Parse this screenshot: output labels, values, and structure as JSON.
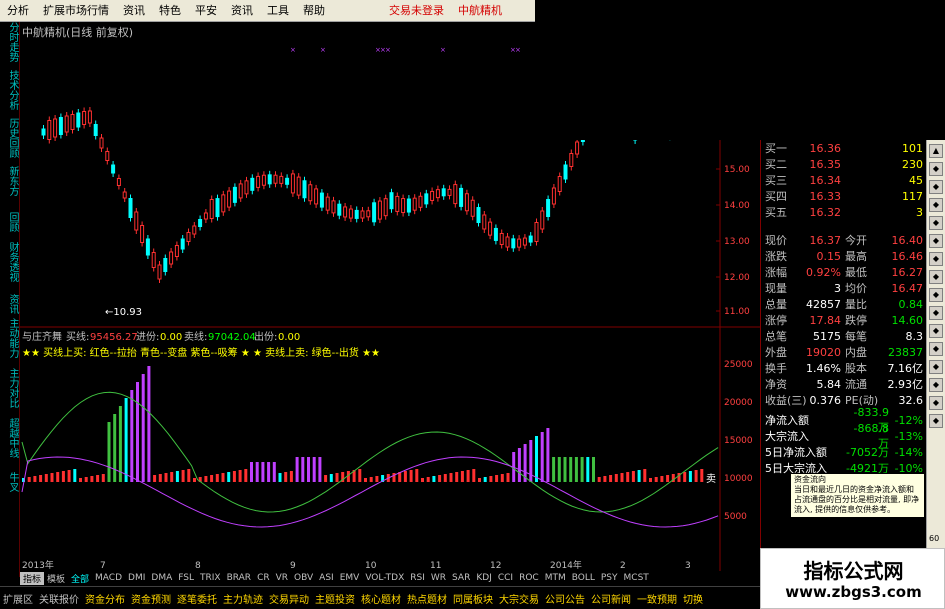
{
  "menubar": {
    "items": [
      "分析",
      "扩展市场行情",
      "资讯",
      "特色",
      "平安",
      "资讯",
      "工具",
      "帮助"
    ],
    "status": "交易未登录",
    "stock_name": "中航精机"
  },
  "left_nav": [
    "分时走势",
    "技术分析",
    "历史回顾",
    "新东方",
    "回顾",
    "财务透视",
    "资讯",
    "主动能力",
    "主力对比",
    "超越中线",
    "牛叉"
  ],
  "chart": {
    "title": "中航精机(日线 前复权)",
    "low_label": "←10.93",
    "price_axis": [
      "15.00",
      "14.00",
      "13.00",
      "12.00",
      "11.00"
    ],
    "indicator_title": "与庄齐舞",
    "indicator_values": {
      "buy_label": "买线:",
      "buy_value": "95456.27",
      "enter_label": "进份:",
      "enter_value": "0.00",
      "sell_label": "卖线:",
      "sell_value": "97042.04",
      "exit_label": "出份:",
      "exit_value": "0.00"
    },
    "legend_text": "★★ 买线上买: 红色--拉抬 青色--变盘 紫色--吸筹 ★ ★ 卖线上卖: 绿色--出货 ★★",
    "volume_axis": [
      "25000",
      "20000",
      "15000",
      "10000",
      "5000"
    ],
    "date_labels": [
      "2013年",
      "7",
      "8",
      "9",
      "10",
      "11",
      "12",
      "2014年",
      "2",
      "3"
    ],
    "sell_marker": "卖"
  },
  "quotes": {
    "buy": [
      {
        "label": "买一",
        "price": "16.36",
        "vol": "101"
      },
      {
        "label": "买二",
        "price": "16.35",
        "vol": "230"
      },
      {
        "label": "买三",
        "price": "16.34",
        "vol": "45"
      },
      {
        "label": "买四",
        "price": "16.33",
        "vol": "117"
      },
      {
        "label": "买五",
        "price": "16.32",
        "vol": "3"
      }
    ],
    "stats": [
      {
        "l1": "现价",
        "v1": "16.37",
        "c1": "red",
        "l2": "今开",
        "v2": "16.40",
        "c2": "red"
      },
      {
        "l1": "涨跌",
        "v1": "0.15",
        "c1": "red",
        "l2": "最高",
        "v2": "16.46",
        "c2": "red"
      },
      {
        "l1": "涨幅",
        "v1": "0.92%",
        "c1": "red",
        "l2": "最低",
        "v2": "16.27",
        "c2": "red"
      },
      {
        "l1": "现量",
        "v1": "3",
        "c1": "white",
        "l2": "均价",
        "v2": "16.47",
        "c2": "red"
      },
      {
        "l1": "总量",
        "v1": "42857",
        "c1": "white",
        "l2": "量比",
        "v2": "0.84",
        "c2": "green"
      },
      {
        "l1": "涨停",
        "v1": "17.84",
        "c1": "red",
        "l2": "跌停",
        "v2": "14.60",
        "c2": "green"
      },
      {
        "l1": "总笔",
        "v1": "5175",
        "c1": "white",
        "l2": "每笔",
        "v2": "8.3",
        "c2": "white"
      },
      {
        "l1": "外盘",
        "v1": "19020",
        "c1": "red",
        "l2": "内盘",
        "v2": "23837",
        "c2": "green"
      },
      {
        "l1": "换手",
        "v1": "1.46%",
        "c1": "white",
        "l2": "股本",
        "v2": "7.16亿",
        "c2": "white"
      },
      {
        "l1": "净资",
        "v1": "5.84",
        "c1": "white",
        "l2": "流通",
        "v2": "2.93亿",
        "c2": "white"
      },
      {
        "l1": "收益(三)",
        "v1": "0.376",
        "c1": "white",
        "l2": "PE(动)",
        "v2": "32.6",
        "c2": "white"
      }
    ],
    "flows": [
      {
        "label": "净流入额",
        "value": "-833.9万",
        "pct": "-12%"
      },
      {
        "label": "大宗流入",
        "value": "-868.8万",
        "pct": "-13%"
      },
      {
        "label": "5日净流入额",
        "value": "-7052万",
        "pct": "-14%"
      },
      {
        "label": "5日大宗流入",
        "value": "-4921万",
        "pct": "-10%"
      }
    ]
  },
  "tooltip": {
    "title": "资金流向",
    "body": "当日和最近几日的资金净流入额和占流通盘的百分比是相对流量, 即净流入, 提供的信息仅供参考。"
  },
  "indicator_tabs": [
    "指标",
    "模板",
    "全部",
    "MACD",
    "DMI",
    "DMA",
    "FSL",
    "TRIX",
    "BRAR",
    "CR",
    "VR",
    "OBV",
    "ASI",
    "EMV",
    "VOL-TDX",
    "RSI",
    "WR",
    "SAR",
    "KDJ",
    "CCI",
    "ROC",
    "MTM",
    "BOLL",
    "PSY",
    "MCST"
  ],
  "active_indicator_tab": "指标",
  "bottom_bar": [
    "扩展区",
    "关联报价",
    "资金分布",
    "资金预测",
    "逐笔委托",
    "主力轨迹",
    "交易异动",
    "主题投资",
    "核心题材",
    "热点题材",
    "同属板块",
    "大宗交易",
    "公司公告",
    "公司新闻",
    "一致预期",
    "切换"
  ],
  "watermark": {
    "line1": "指标公式网",
    "line2": "www.zbgs3.com"
  },
  "scroll_right_value": "60",
  "colors": {
    "up": "#ff3030",
    "down": "#00ffff",
    "purple": "#c040ff",
    "green_bar": "#40c040",
    "grid_red": "#800000"
  }
}
